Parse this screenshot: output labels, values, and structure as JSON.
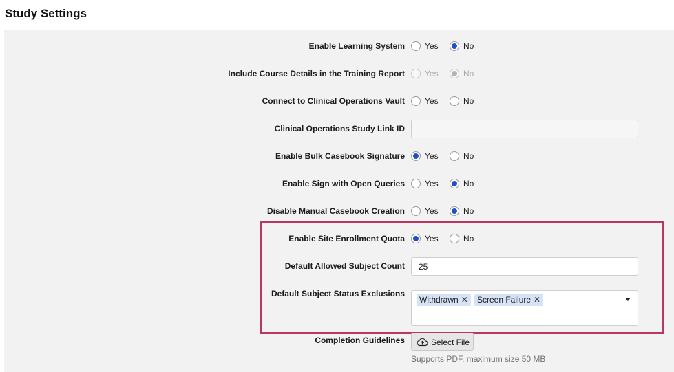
{
  "page": {
    "title": "Study Settings"
  },
  "settings": {
    "enable_learning_system": {
      "label": "Enable Learning System",
      "yes_label": "Yes",
      "no_label": "No",
      "selected": "No"
    },
    "include_course_details": {
      "label": "Include Course Details in the Training Report",
      "yes_label": "Yes",
      "no_label": "No",
      "selected": "No",
      "disabled": true
    },
    "connect_clinical_ops_vault": {
      "label": "Connect to Clinical Operations Vault",
      "yes_label": "Yes",
      "no_label": "No",
      "selected": ""
    },
    "clinical_ops_study_link_id": {
      "label": "Clinical Operations Study Link ID",
      "value": ""
    },
    "enable_bulk_casebook_signature": {
      "label": "Enable Bulk Casebook Signature",
      "yes_label": "Yes",
      "no_label": "No",
      "selected": "Yes"
    },
    "enable_sign_open_queries": {
      "label": "Enable Sign with Open Queries",
      "yes_label": "Yes",
      "no_label": "No",
      "selected": "No"
    },
    "disable_manual_casebook_creation": {
      "label": "Disable Manual Casebook Creation",
      "yes_label": "Yes",
      "no_label": "No",
      "selected": "No"
    },
    "enable_site_enrollment_quota": {
      "label": "Enable Site Enrollment Quota",
      "yes_label": "Yes",
      "no_label": "No",
      "selected": "Yes"
    },
    "default_allowed_subject_count": {
      "label": "Default Allowed Subject Count",
      "value": "25"
    },
    "default_subject_status_exclusions": {
      "label": "Default Subject Status Exclusions",
      "tags": [
        "Withdrawn",
        "Screen Failure"
      ],
      "remove_glyph": "✕"
    },
    "completion_guidelines": {
      "label": "Completion Guidelines",
      "button_label": "Select File",
      "hint": "Supports PDF, maximum size 50 MB"
    }
  },
  "colors": {
    "accent": "#1f4fc4",
    "highlight_border": "#b73765",
    "panel_bg": "#f2f2f2",
    "tag_bg": "#d6e2f5"
  },
  "icons": {
    "upload": "cloud-upload-icon",
    "remove_tag": "close-icon",
    "dropdown": "chevron-down-icon"
  }
}
